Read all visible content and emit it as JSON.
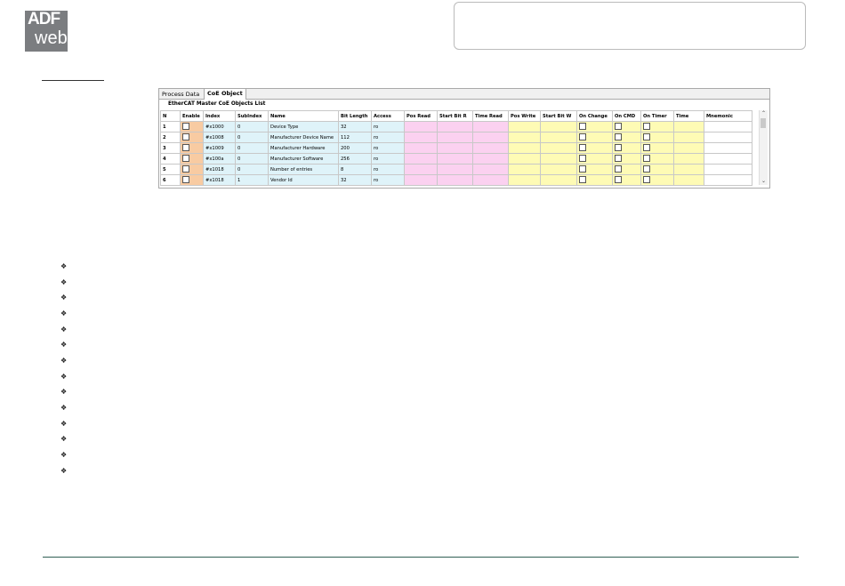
{
  "logo": {
    "line1": "ADF",
    "line2": "web"
  },
  "tabs": [
    {
      "label": "Process Data"
    },
    {
      "label": "CoE Object"
    }
  ],
  "caption": "EtherCAT Master CoE Objects List",
  "columns": [
    "N",
    "Enable",
    "Index",
    "SubIndex",
    "Name",
    "Bit Length",
    "Access",
    "Pos Read",
    "Start Bit R",
    "Time Read",
    "Pos Write",
    "Start Bit W",
    "On Change",
    "On CMD",
    "On Timer",
    "Time",
    "Mnemonic"
  ],
  "rows": [
    {
      "n": "1",
      "index": "#x1000",
      "subindex": "0",
      "name": "Device Type",
      "bitlength": "32",
      "access": "ro"
    },
    {
      "n": "2",
      "index": "#x1008",
      "subindex": "0",
      "name": "Manufacturer Device Name",
      "bitlength": "112",
      "access": "ro"
    },
    {
      "n": "3",
      "index": "#x1009",
      "subindex": "0",
      "name": "Manufacturer Hardware",
      "bitlength": "200",
      "access": "ro"
    },
    {
      "n": "4",
      "index": "#x100a",
      "subindex": "0",
      "name": "Manufacturer Software",
      "bitlength": "256",
      "access": "ro"
    },
    {
      "n": "5",
      "index": "#x1018",
      "subindex": "0",
      "name": "Number of entries",
      "bitlength": "8",
      "access": "ro"
    },
    {
      "n": "6",
      "index": "#x1018",
      "subindex": "1",
      "name": "Vendor Id",
      "bitlength": "32",
      "access": "ro"
    }
  ],
  "bullet_count": 14,
  "colors": {
    "enable": "#f8cba2",
    "info": "#dff3f9",
    "read": "#fbd1f0",
    "write": "#fefbb5",
    "footer_rule": "#2f5f54"
  }
}
